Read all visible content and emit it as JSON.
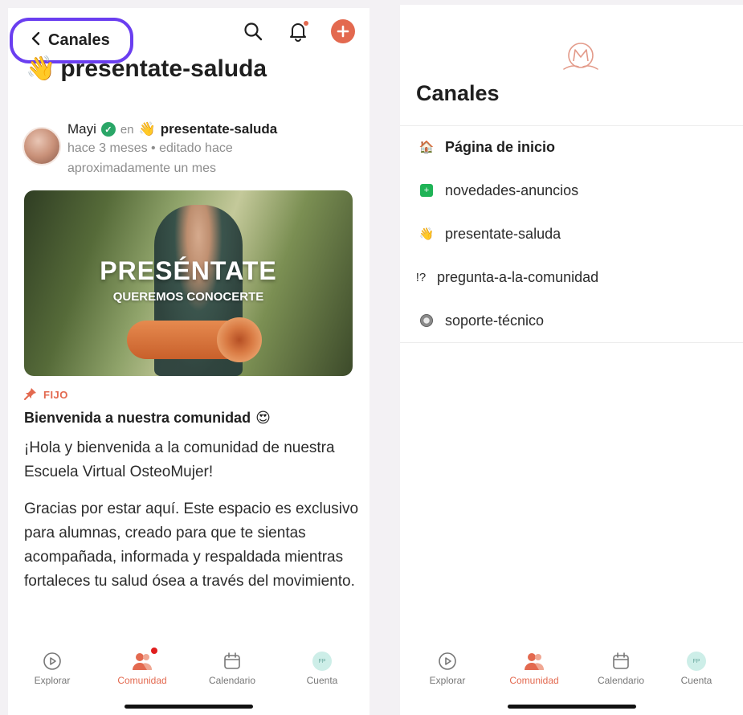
{
  "left": {
    "header": {
      "back_label": "Canales",
      "channel_emoji": "👋",
      "channel_name": "presentate-saluda"
    },
    "post": {
      "author": "Mayi",
      "in_word": "en",
      "channel_emoji": "👋",
      "channel": "presentate-saluda",
      "time": "hace 3 meses • editado hace aproximadamente un mes",
      "image_title": "PRESÉNTATE",
      "image_subtitle": "QUEREMOS CONOCERTE",
      "pinned_label": "FIJO",
      "title": "Bienvenida a nuestra comunidad",
      "title_emoji": "😍",
      "body": [
        "¡Hola y bienvenida a la comunidad de nuestra Escuela Virtual OsteoMujer!",
        "Gracias por estar aquí. Este espacio es exclusivo para alumnas, creado para que te sientas acompañada, informada y respaldada mientras fortaleces tu salud ósea a través del movimiento."
      ]
    },
    "tabs": [
      {
        "label": "Explorar",
        "icon": "play-circle-icon"
      },
      {
        "label": "Comunidad",
        "icon": "people-icon",
        "active": true
      },
      {
        "label": "Calendario",
        "icon": "calendar-icon"
      },
      {
        "label": "Cuenta",
        "icon": "avatar-icon",
        "initials": "FP"
      }
    ]
  },
  "right": {
    "title": "Canales",
    "channels": [
      {
        "emoji": "🏠",
        "label": "Página de inicio"
      },
      {
        "emoji": "+",
        "label": "novedades-anuncios"
      },
      {
        "emoji": "👋",
        "label": "presentate-saluda"
      },
      {
        "emoji": "!?",
        "label": "pregunta-a-la-comunidad"
      },
      {
        "emoji": "⚙",
        "label": "soporte-técnico"
      }
    ],
    "tabs": [
      {
        "label": "Explorar",
        "icon": "play-circle-icon"
      },
      {
        "label": "Comunidad",
        "icon": "people-icon",
        "active": true
      },
      {
        "label": "Calendario",
        "icon": "calendar-icon"
      },
      {
        "label": "Cuenta",
        "icon": "avatar-icon",
        "initials": "FP"
      }
    ]
  },
  "colors": {
    "accent": "#e3694f",
    "highlight": "#6a3ef0",
    "verified": "#2aa667"
  }
}
